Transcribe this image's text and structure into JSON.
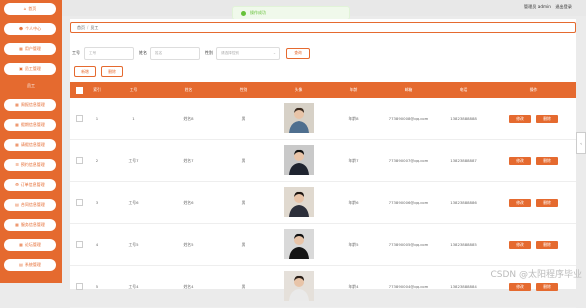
{
  "sidebar": {
    "items": [
      {
        "label": "首页",
        "icon": "home-icon",
        "glyph": "⌂"
      },
      {
        "label": "个人中心",
        "icon": "user-icon",
        "glyph": "☻"
      },
      {
        "label": "用户管理",
        "icon": "users-icon",
        "glyph": "▦"
      },
      {
        "label": "员工管理",
        "icon": "staff-icon",
        "glyph": "▣"
      },
      {
        "label": "员工",
        "icon": "",
        "glyph": ""
      },
      {
        "label": "周报信息管理",
        "icon": "report-icon",
        "glyph": "▦"
      },
      {
        "label": "假期信息管理",
        "icon": "calendar-icon",
        "glyph": "▦"
      },
      {
        "label": "请假信息管理",
        "icon": "leave-icon",
        "glyph": "▦"
      },
      {
        "label": "预约信息管理",
        "icon": "appointment-icon",
        "glyph": "☰"
      },
      {
        "label": "订单信息管理",
        "icon": "order-icon",
        "glyph": "⛃"
      },
      {
        "label": "合同信息管理",
        "icon": "contract-icon",
        "glyph": "▤"
      },
      {
        "label": "服务信息管理",
        "icon": "service-icon",
        "glyph": "▦"
      },
      {
        "label": "论坛管理",
        "icon": "forum-icon",
        "glyph": "▦"
      },
      {
        "label": "系统管理",
        "icon": "settings-icon",
        "glyph": "▤"
      }
    ]
  },
  "header": {
    "admin_text": "管理员 admin",
    "logout": "退出登录"
  },
  "toast": {
    "text": "操作成功"
  },
  "breadcrumb": {
    "home": "首页",
    "sep": "/",
    "current": "员工"
  },
  "search": {
    "label_id": "工号",
    "placeholder_id": "工号",
    "label_name": "姓名",
    "placeholder_name": "姓名",
    "label_gender": "性别",
    "placeholder_gender": "请选择性别",
    "query_button": "查询"
  },
  "actions": {
    "add": "新增",
    "delete": "删除"
  },
  "table": {
    "headers": [
      "",
      "索引",
      "工号",
      "姓名",
      "性别",
      "头像",
      "年龄",
      "邮箱",
      "电话",
      "操作"
    ],
    "edit_label": "修改",
    "delete_label": "删除",
    "rows": [
      {
        "idx": "1",
        "id": "1",
        "name": "姓名8",
        "gender": "男",
        "age": "年龄8",
        "email": "773890008@qq.com",
        "phone": "13823888888"
      },
      {
        "idx": "2",
        "id": "工号7",
        "name": "姓名7",
        "gender": "男",
        "age": "年龄7",
        "email": "773890007@qq.com",
        "phone": "13823888887"
      },
      {
        "idx": "3",
        "id": "工号6",
        "name": "姓名6",
        "gender": "男",
        "age": "年龄6",
        "email": "773890006@qq.com",
        "phone": "13823888886"
      },
      {
        "idx": "4",
        "id": "工号5",
        "name": "姓名5",
        "gender": "男",
        "age": "年龄5",
        "email": "773890005@qq.com",
        "phone": "13823888885"
      },
      {
        "idx": "5",
        "id": "工号4",
        "name": "姓名4",
        "gender": "男",
        "age": "年龄4",
        "email": "773890004@qq.com",
        "phone": "13823888884"
      }
    ]
  },
  "watermark": "CSDN @太阳程序毕业",
  "scroll_arrow": "‹",
  "colors": {
    "accent": "#e56a2f",
    "toast": "#67c23a"
  }
}
